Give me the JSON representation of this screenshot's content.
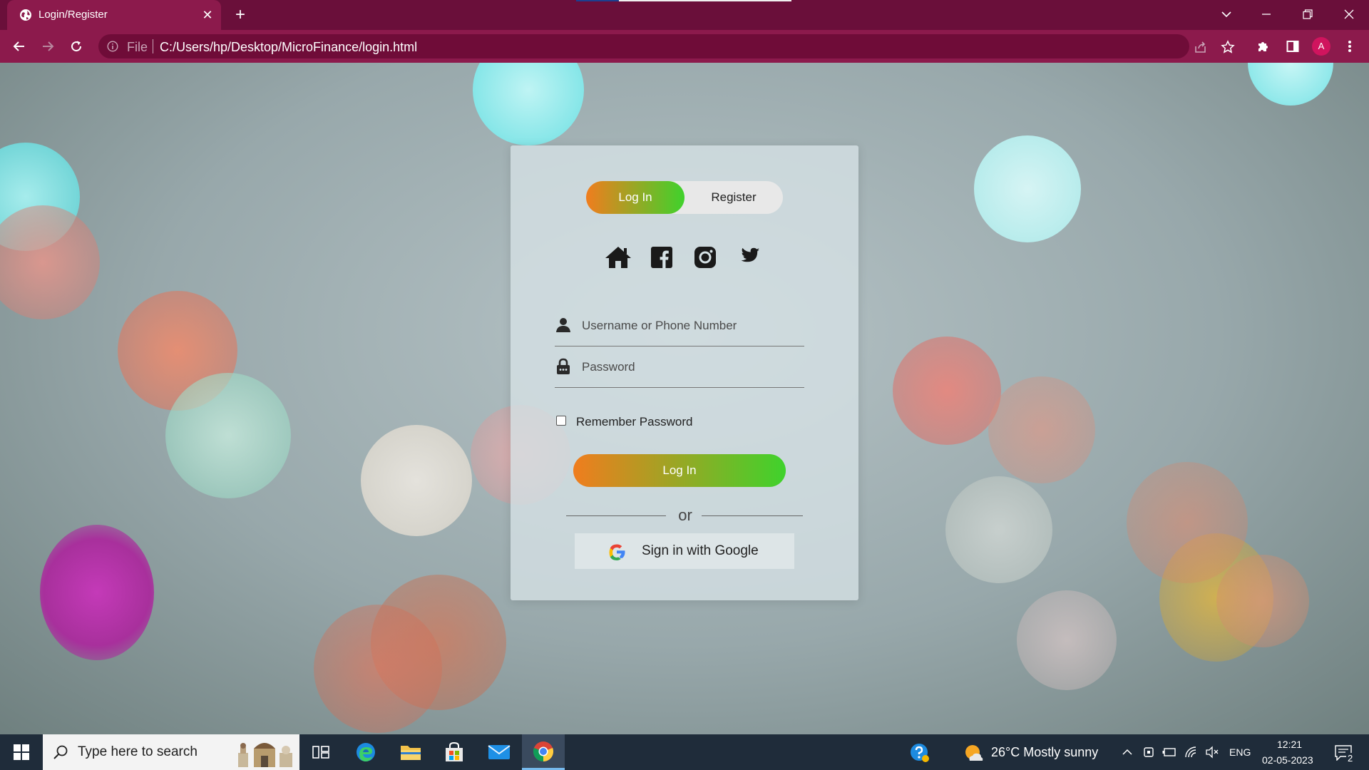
{
  "browser": {
    "tab_title": "Login/Register",
    "tab_close": "✕",
    "new_tab": "+",
    "scheme_label": "File",
    "url": "C:/Users/hp/Desktop/MicroFinance/login.html",
    "profile_initial": "A",
    "theme_color": "#8c1a4c"
  },
  "login_card": {
    "toggle": {
      "login_label": "Log In",
      "register_label": "Register",
      "active": "Log In"
    },
    "social_icons": [
      "home-icon",
      "facebook-icon",
      "instagram-icon",
      "twitter-icon"
    ],
    "username_placeholder": "Username or Phone Number",
    "password_placeholder": "Password",
    "remember_label": "Remember Password",
    "remember_checked": false,
    "submit_label": "Log In",
    "divider_text": "or",
    "google_label": "Sign in with Google",
    "gradient_colors": [
      "#f07d1e",
      "#3fd22c"
    ]
  },
  "taskbar": {
    "search_placeholder": "Type here to search",
    "pinned_apps": [
      "task-view-icon",
      "edge-icon",
      "file-explorer-icon",
      "store-icon",
      "mail-icon",
      "chrome-icon"
    ],
    "weather": "26°C  Mostly sunny",
    "language": "ENG",
    "time": "12:21",
    "date": "02-05-2023",
    "notification_count": "2"
  }
}
